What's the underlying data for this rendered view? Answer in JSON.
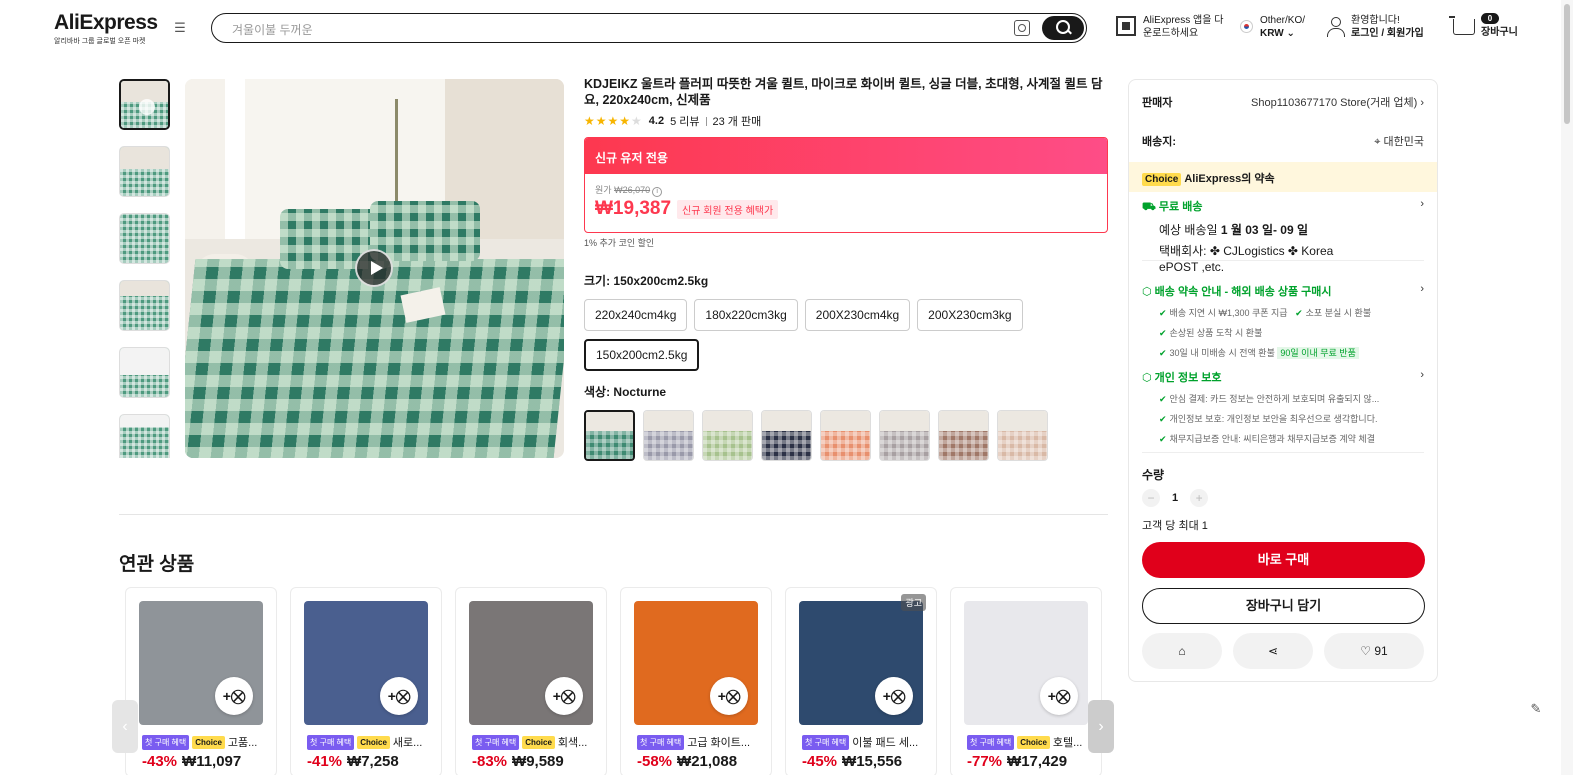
{
  "header": {
    "brand": "AliExpress",
    "tagline": "알리바바 그룹 글로벌 오픈 마켓",
    "search_placeholder": "겨울이불 두꺼운",
    "app_line1": "AliExpress 앱을 다",
    "app_line2": "운로드하세요",
    "region_line1": "Other/KO/",
    "region_line2": "KRW ⌄",
    "user_line1": "환영합니다!",
    "user_line2": "로그인 / 회원가입",
    "cart_count": "0",
    "cart_label": "장바구니"
  },
  "product": {
    "title": "KDJEIKZ 울트라 플러피 따뜻한 겨울 퀼트, 마이크로 화이버 퀼트, 싱글 더블, 초대형, 사계절 퀼트 담요, 220x240cm, 신제품",
    "rating": "4.2",
    "rating_value": 4.2,
    "reviews": "5 리뷰",
    "sold": "23 개 판매",
    "promo_banner": "신규 유저 전용",
    "orig_label": "원가",
    "orig_price": "₩26,070",
    "price": "₩19,387",
    "price_tag": "신규 회원 전용 혜택가",
    "coin_note": "1% 추가 코인 할인",
    "size_label": "크기: 150x200cm2.5kg",
    "sizes": [
      "220x240cm4kg",
      "180x220cm3kg",
      "200X230cm4kg",
      "200X230cm3kg",
      "150x200cm2.5kg"
    ],
    "selected_size_index": 4,
    "color_label": "색상: Nocturne",
    "color_swatches": [
      "#3f8a72",
      "#9a9aaa",
      "#a7c28e",
      "#2c3246",
      "#e8906e",
      "#a8a0a2",
      "#a07868",
      "#d9b9a6"
    ],
    "selected_color_index": 0
  },
  "panel": {
    "seller_label": "판매자",
    "seller_value": "Shop1103677170 Store(거래 업체) ›",
    "ship_label": "배송지:",
    "ship_value": "⌖ 대한민국",
    "choice_badge": "Choice",
    "choice_promise": "AliExpress의 약속",
    "free_ship": "무료 배송",
    "eta_prefix": "예상 배송일 ",
    "eta_dates": "1 월 03 일- 09 일",
    "carrier_line1": "택배회사:  ✤  CJLogistics  ✤  Korea",
    "carrier_line2": "ePOST ,etc.",
    "delivery_guide": "배송 약속 안내 - 해외 배송 상품 구매시",
    "guide_items": [
      "배송 지연 시 ₩1,300 쿠폰 지급",
      "소포 분실 시 환불",
      "손상된 상품 도착 시 환불",
      "30일 내 미배송 시 전액 환불"
    ],
    "guide_tag": "90일 이내 무료 반품",
    "privacy_title": "개인 정보 보호",
    "privacy_items": [
      "안심 결제: 카드 정보는 안전하게 보호되며 유출되지 않...",
      "개인정보 보호: 개인정보 보안을 최우선으로 생각합니다.",
      "채무지급보증 안내: 씨티은행과 채무지급보증 계약 체결"
    ],
    "qty_label": "수량",
    "qty_value": "1",
    "qty_limit": "고객 당 최대 1",
    "buy_now": "바로 구매",
    "add_to_cart": "장바구니 담기",
    "wishlist_count": "91"
  },
  "related": {
    "title": "연관 상품",
    "first_purchase_tag": "첫 구매 혜택",
    "choice_tag": "Choice",
    "ad_label": "광고",
    "items": [
      {
        "name": "고품...",
        "discount": "-43%",
        "price": "₩11,097",
        "choice": true,
        "ad": false,
        "color": "#8f9499"
      },
      {
        "name": "새로...",
        "discount": "-41%",
        "price": "₩7,258",
        "choice": true,
        "ad": false,
        "color": "#4a5f8f"
      },
      {
        "name": "회색...",
        "discount": "-83%",
        "price": "₩9,589",
        "choice": true,
        "ad": false,
        "color": "#7a7676"
      },
      {
        "name": "고급 화이트...",
        "discount": "-58%",
        "price": "₩21,088",
        "choice": false,
        "ad": false,
        "color": "#e06a1f"
      },
      {
        "name": "이불 패드 세...",
        "discount": "-45%",
        "price": "₩15,556",
        "choice": false,
        "ad": true,
        "color": "#2e4a6e"
      },
      {
        "name": "호텔...",
        "discount": "-77%",
        "price": "₩17,429",
        "choice": true,
        "ad": false,
        "color": "#e8e8ec"
      }
    ]
  },
  "colors": {
    "accent_red": "#e0001b",
    "promo_red": "#fd384f",
    "green": "#00a22c",
    "choice_yellow": "#ffdb4d"
  }
}
